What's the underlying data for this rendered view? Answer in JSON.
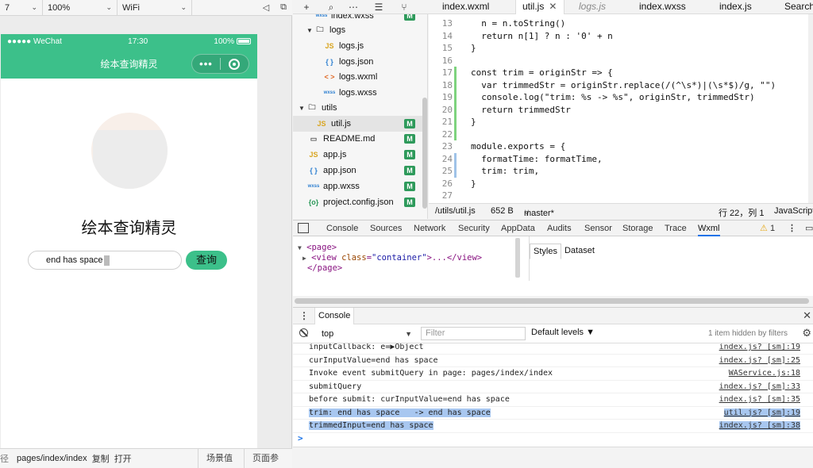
{
  "simulator": {
    "toolbar": {
      "device": "7",
      "zoom": "100%",
      "network": "WiFi"
    },
    "status_bar": {
      "carrier": "●●●●● WeChat",
      "time": "17:30",
      "battery": "100%"
    },
    "nav_title": "绘本查询精灵",
    "capsule_dots": "•••",
    "app_title": "绘本查询精灵",
    "input_value": "end has space",
    "query_button": "查询",
    "footer": {
      "prefix": "径",
      "path": "pages/index/index",
      "copy": "复制",
      "open": "打开",
      "scene": "场景值",
      "params": "页面参数"
    }
  },
  "editor": {
    "tabs": [
      "index.wxml",
      "util.js",
      "logs.js",
      "index.wxss",
      "index.js",
      "Search"
    ],
    "tree": [
      {
        "label": "index.wxss",
        "icon": "wxss",
        "badge": "M"
      },
      {
        "label": "logs",
        "icon": "folder",
        "badge": ""
      },
      {
        "label": "logs.js",
        "icon": "js",
        "badge": ""
      },
      {
        "label": "logs.json",
        "icon": "json",
        "badge": ""
      },
      {
        "label": "logs.wxml",
        "icon": "wxml",
        "badge": ""
      },
      {
        "label": "logs.wxss",
        "icon": "wxss",
        "badge": ""
      },
      {
        "label": "utils",
        "icon": "folder",
        "badge": ""
      },
      {
        "label": "util.js",
        "icon": "js",
        "badge": "M"
      },
      {
        "label": "README.md",
        "icon": "md",
        "badge": "M"
      },
      {
        "label": "app.js",
        "icon": "js",
        "badge": "M"
      },
      {
        "label": "app.json",
        "icon": "json",
        "badge": "M"
      },
      {
        "label": "app.wxss",
        "icon": "wxss",
        "badge": "M"
      },
      {
        "label": "project.config.json",
        "icon": "cfg",
        "badge": "M"
      }
    ],
    "icon_text": {
      "js": "JS",
      "json": "{ }",
      "wxml": "< >",
      "wxss": "wxss",
      "cfg": "{o}",
      "folder": "🗀",
      "md": ""
    },
    "code": [
      {
        "n": "13",
        "t": "  n = n.toString()"
      },
      {
        "n": "14",
        "t": "  return n[1] ? n : '0' + n"
      },
      {
        "n": "15",
        "t": "}"
      },
      {
        "n": "16",
        "t": ""
      },
      {
        "n": "17",
        "t": "const trim = originStr => {"
      },
      {
        "n": "18",
        "t": "  var trimmedStr = originStr.replace(/(^\\s*)|(\\s*$)/g, \"\")"
      },
      {
        "n": "19",
        "t": "  console.log(\"trim: %s -> %s\", originStr, trimmedStr)"
      },
      {
        "n": "20",
        "t": "  return trimmedStr"
      },
      {
        "n": "21",
        "t": "}"
      },
      {
        "n": "22",
        "t": ""
      },
      {
        "n": "23",
        "t": "module.exports = {"
      },
      {
        "n": "24",
        "t": "  formatTime: formatTime,"
      },
      {
        "n": "25",
        "t": "  trim: trim,"
      },
      {
        "n": "26",
        "t": "}"
      },
      {
        "n": "27",
        "t": ""
      }
    ],
    "status": {
      "path": "/utils/util.js",
      "size": "652 B",
      "branch": "master*",
      "position": "行 22，列 1",
      "language": "JavaScript"
    }
  },
  "devtools": {
    "tabs": [
      "Console",
      "Sources",
      "Network",
      "Security",
      "AppData",
      "Audits",
      "Sensor",
      "Storage",
      "Trace",
      "Wxml"
    ],
    "active_tab": "Wxml",
    "warnings": "1",
    "dom": {
      "line1": "<page>",
      "tag2": "<view",
      "attr2": "class",
      "val2": "\"container\"",
      "rest2": ">...</view>",
      "line3": "</page>"
    },
    "styles_tabs": [
      "Styles",
      "Dataset"
    ]
  },
  "console": {
    "tab": "Console",
    "context": "top",
    "filter_placeholder": "Filter",
    "levels": "Default levels ▼",
    "hidden": "1 item hidden by filters",
    "logs": [
      {
        "msg": "inputCallback: e=▶Object",
        "src": "index.js? [sm]:19",
        "hl": false
      },
      {
        "msg": "curInputValue=end has space",
        "src": "index.js? [sm]:25",
        "hl": false
      },
      {
        "msg": "Invoke event submitQuery in page: pages/index/index",
        "src": "WAService.js:18",
        "hl": false
      },
      {
        "msg": "submitQuery",
        "src": "index.js? [sm]:33",
        "hl": false
      },
      {
        "msg": "before submit: curInputValue=end has space",
        "src": "index.js? [sm]:35",
        "hl": false
      },
      {
        "msg": "trim: end has space   -> end has space",
        "src": "util.js? [sm]:19",
        "hl": true
      },
      {
        "msg": "trimmedInput=end has space",
        "src": "index.js? [sm]:38",
        "hl": true
      }
    ],
    "prompt": ">"
  },
  "colors": {
    "wechat_green": "#3cc08a",
    "badge_green": "#2e9a5b",
    "highlight": "#a8c7f0"
  }
}
